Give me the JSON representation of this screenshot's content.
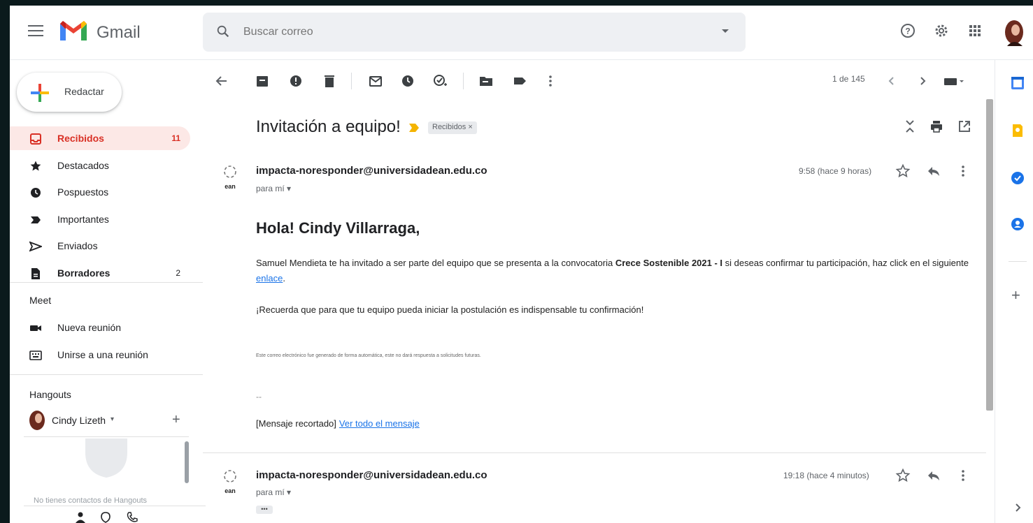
{
  "app": {
    "title": "Gmail"
  },
  "search": {
    "placeholder": "Buscar correo"
  },
  "sidebar": {
    "compose_label": "Redactar",
    "items": [
      {
        "label": "Recibidos",
        "count": "11"
      },
      {
        "label": "Destacados",
        "count": ""
      },
      {
        "label": "Pospuestos",
        "count": ""
      },
      {
        "label": "Importantes",
        "count": ""
      },
      {
        "label": "Enviados",
        "count": ""
      },
      {
        "label": "Borradores",
        "count": "2"
      }
    ],
    "meet": {
      "title": "Meet",
      "items": [
        "Nueva reunión",
        "Unirse a una reunión"
      ]
    },
    "hangouts": {
      "title": "Hangouts",
      "user": "Cindy Lizeth",
      "empty_text": "No tienes contactos de Hangouts"
    }
  },
  "toolbar": {
    "pager": "1 de 145"
  },
  "thread": {
    "subject": "Invitación a equipo!",
    "label_chip": "Recibidos",
    "messages": [
      {
        "sender": "impacta-noresponder@universidadean.edu.co",
        "to": "para mí",
        "time": "9:58 (hace 9 horas)",
        "greeting": "Hola! Cindy Villarraga,",
        "para1_pre": "Samuel Mendieta te ha invitado a ser parte del equipo que se presenta a la convocatoria ",
        "para1_bold": "Crece Sostenible 2021 - I",
        "para1_post": " si deseas confirmar tu participación, haz click en el siguiente ",
        "para1_link": "enlace",
        "para2": "¡Recuerda que para que tu equipo pueda iniciar la postulación es indispensable tu confirmación!",
        "footer_small": "Este correo electrónico fue generado de forma automática, este no dará respuesta a solicitudes futuras.",
        "separator": "--",
        "clipped_label": "[Mensaje recortado]",
        "clipped_link": "Ver todo el mensaje"
      },
      {
        "sender": "impacta-noresponder@universidadean.edu.co",
        "to": "para mí",
        "time": "19:18 (hace 4 minutos)",
        "dots": "•••"
      }
    ]
  },
  "colors": {
    "accent_red": "#d93025",
    "active_bg": "#fce8e6",
    "link_blue": "#1a73e8"
  },
  "icons": [
    "menu-icon",
    "gmail-logo",
    "search-icon",
    "help-icon",
    "settings-icon",
    "apps-icon",
    "back-icon",
    "archive-icon",
    "report-spam-icon",
    "delete-icon",
    "mark-unread-icon",
    "snooze-icon",
    "add-task-icon",
    "move-to-icon",
    "label-icon",
    "more-icon",
    "calendar-icon",
    "keep-icon",
    "tasks-icon",
    "contacts-icon"
  ]
}
